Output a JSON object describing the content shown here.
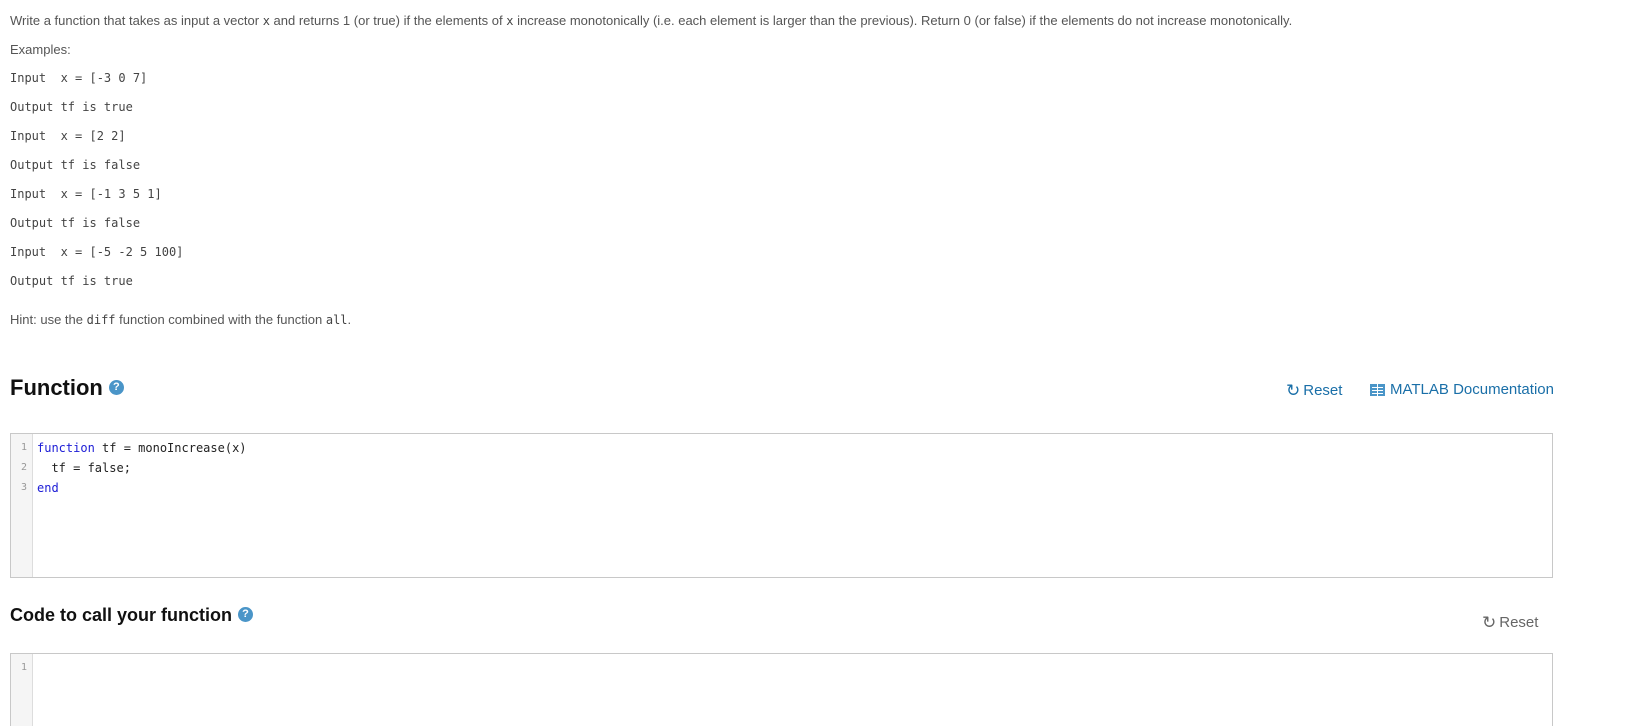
{
  "problem": {
    "description_before_x1": "Write a function that takes as input a vector",
    "description_var1": "x",
    "description_between": "and returns 1 (or true) if the elements of",
    "description_var2": "x",
    "description_after": "increase monotonically (i.e. each element is larger than the previous). Return 0 (or false) if the elements do not increase monotonically.",
    "examples_label": "Examples:",
    "examples": [
      "Input  x = [-3 0 7]",
      "Output tf is true",
      "Input  x = [2 2]",
      "Output tf is false",
      "Input  x = [-1 3 5 1]",
      "Output tf is false",
      "Input  x = [-5 -2 5 100]",
      "Output tf is true"
    ],
    "hint_prefix": "Hint: use the",
    "hint_code1": "diff",
    "hint_middle": "function combined with the function",
    "hint_code2": "all",
    "hint_suffix": "."
  },
  "function_section": {
    "title": "Function",
    "help_glyph": "?",
    "reset_label": "Reset",
    "doc_label": "MATLAB Documentation",
    "line_numbers": [
      "1",
      "2",
      "3"
    ],
    "code_line1_kw": "function",
    "code_line1_rest": " tf = monoIncrease(x)",
    "code_line2": "  tf = false;",
    "code_line3_kw": "end"
  },
  "call_section": {
    "title": "Code to call your function",
    "help_glyph": "?",
    "reset_label": "Reset",
    "line_numbers": [
      "1"
    ]
  },
  "colors": {
    "link": "#1a6fa8",
    "help_icon": "#4a95c8",
    "keyword": "#1c1cd6"
  },
  "icons": {
    "reset": "refresh-icon",
    "documentation": "book-icon",
    "help": "help-icon"
  }
}
